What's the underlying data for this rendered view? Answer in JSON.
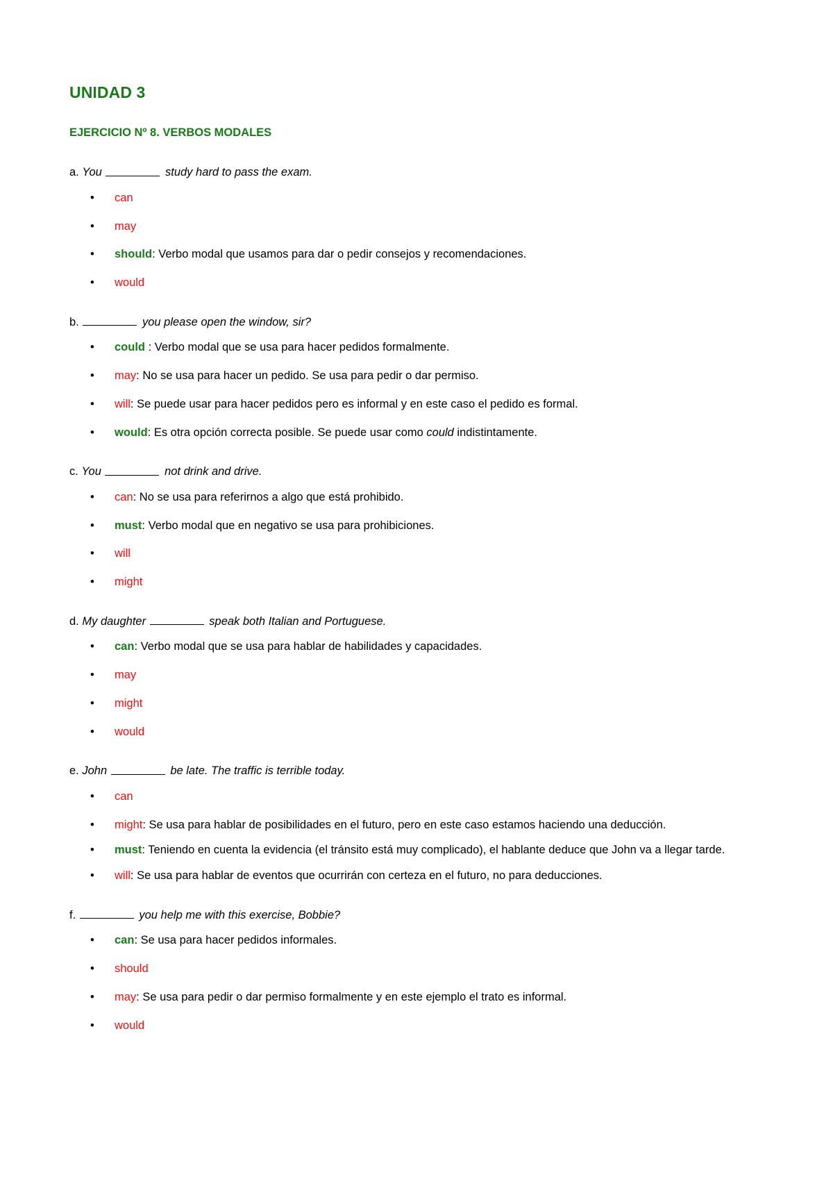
{
  "document": {
    "title": "UNIDAD 3",
    "exercise_title": "EJERCICIO Nº 8. VERBOS MODALES"
  },
  "colors": {
    "correct_green": "#1a7a1a",
    "wrong_red": "#ee1111",
    "body_black": "#000000",
    "page_background": "#ffffff"
  },
  "bullet_glyph": "•",
  "questions": [
    {
      "letter": "a.",
      "stem_before_blank": "You",
      "stem_after_blank": "study hard to pass the exam.",
      "options": [
        {
          "modal": "can",
          "status": "wrong",
          "separator": "",
          "explanation": ""
        },
        {
          "modal": "may",
          "status": "wrong",
          "separator": "",
          "explanation": ""
        },
        {
          "modal": "should",
          "status": "correct",
          "separator": ": ",
          "explanation": "Verbo modal que usamos para dar o pedir consejos y  recomendaciones."
        },
        {
          "modal": "would",
          "status": "wrong",
          "separator": "",
          "explanation": ""
        }
      ]
    },
    {
      "letter": "b.",
      "stem_before_blank": "",
      "stem_after_blank": "you please open the window, sir?",
      "options": [
        {
          "modal": "could",
          "status": "correct",
          "separator": " : ",
          "explanation": "Verbo modal que se usa para hacer pedidos formalmente."
        },
        {
          "modal": "may",
          "status": "wrong",
          "separator": ": ",
          "explanation": "No se usa para hacer un pedido. Se usa para pedir o dar permiso."
        },
        {
          "modal": "will",
          "status": "wrong",
          "separator": ": ",
          "explanation": "Se puede usar para hacer pedidos pero es informal y en este caso el pedido es formal."
        },
        {
          "modal": "would",
          "status": "correct",
          "separator": ": ",
          "explanation_parts": [
            {
              "text": "Es otra opción correcta posible. Se puede usar como ",
              "italic": false
            },
            {
              "text": "could",
              "italic": true
            },
            {
              "text": " indistintamente.",
              "italic": false
            }
          ],
          "explanation": "Es otra opción correcta posible. Se puede usar como could indistintamente."
        }
      ]
    },
    {
      "letter": "c.",
      "stem_before_blank": "You",
      "stem_after_blank": "not drink and drive.",
      "options": [
        {
          "modal": "can",
          "status": "wrong",
          "separator": ": ",
          "explanation": "No se usa para referirnos a algo que está prohibido."
        },
        {
          "modal": "must",
          "status": "correct",
          "separator": ": ",
          "explanation": "Verbo modal que en negativo se usa para prohibiciones."
        },
        {
          "modal": "will",
          "status": "wrong",
          "separator": "",
          "explanation": ""
        },
        {
          "modal": "might",
          "status": "wrong",
          "separator": "",
          "explanation": ""
        }
      ]
    },
    {
      "letter": "d.",
      "stem_before_blank": "My daughter",
      "stem_after_blank": "speak both Italian and Portuguese.",
      "options": [
        {
          "modal": "can",
          "status": "correct",
          "separator": ": ",
          "explanation": "Verbo modal que se usa para hablar de habilidades y capacidades."
        },
        {
          "modal": "may",
          "status": "wrong",
          "separator": "",
          "explanation": ""
        },
        {
          "modal": "might",
          "status": "wrong",
          "separator": "",
          "explanation": ""
        },
        {
          "modal": "would",
          "status": "wrong",
          "separator": "",
          "explanation": ""
        }
      ]
    },
    {
      "letter": "e.",
      "stem_before_blank": "John",
      "stem_after_blank": "be late. The traffic is terrible today.",
      "options": [
        {
          "modal": "can",
          "status": "wrong",
          "separator": "",
          "explanation": ""
        },
        {
          "modal": "might",
          "status": "wrong",
          "separator": ": ",
          "explanation": "Se usa para hablar de posibilidades en el futuro, pero en este caso estamos haciendo una deducción."
        },
        {
          "modal": "must",
          "status": "correct",
          "separator": ": ",
          "explanation": "Teniendo en cuenta la evidencia (el tránsito está muy complicado), el hablante deduce que John va a llegar tarde."
        },
        {
          "modal": "will",
          "status": "wrong",
          "separator": ": ",
          "explanation": "Se usa para hablar de eventos que ocurrirán con certeza en el futuro, no para deducciones."
        }
      ]
    },
    {
      "letter": "f.",
      "stem_before_blank": "",
      "stem_after_blank": "you help me with this exercise, Bobbie?",
      "options": [
        {
          "modal": "can",
          "status": "correct",
          "separator": ": ",
          "explanation": "Se usa para hacer pedidos informales."
        },
        {
          "modal": "should",
          "status": "wrong",
          "separator": "",
          "explanation": ""
        },
        {
          "modal": "may",
          "status": "wrong",
          "separator": ": ",
          "explanation": "Se usa para pedir o dar permiso formalmente y en este ejemplo el trato es informal."
        },
        {
          "modal": "would",
          "status": "wrong",
          "separator": "",
          "explanation": ""
        }
      ]
    }
  ]
}
